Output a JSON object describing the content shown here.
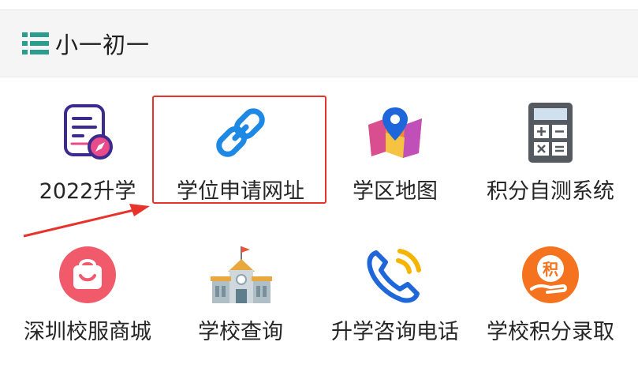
{
  "section": {
    "title": "小一初一"
  },
  "items": [
    {
      "label": "2022升学"
    },
    {
      "label": "学位申请网址"
    },
    {
      "label": "学区地图"
    },
    {
      "label": "积分自测系统"
    },
    {
      "label": "深圳校服商城"
    },
    {
      "label": "学校查询"
    },
    {
      "label": "升学咨询电话"
    },
    {
      "label": "学校积分录取",
      "icon_text": "积"
    }
  ],
  "colors": {
    "accent": "#2a9d8f",
    "highlight": "#e8332d",
    "link_blue": "#1e88e5"
  }
}
